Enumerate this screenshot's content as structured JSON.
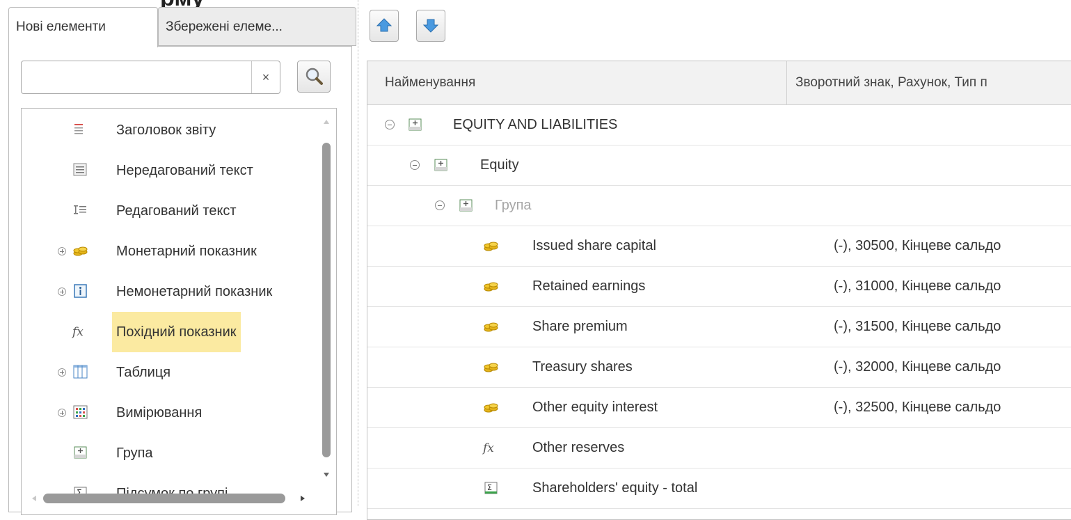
{
  "window": {
    "partial_title": "рму"
  },
  "left_panel": {
    "tabs": [
      {
        "label": "Нові елементи",
        "active": true
      },
      {
        "label": "Збережені елеме...",
        "active": false
      }
    ],
    "search": {
      "value": "",
      "placeholder": "",
      "clear_glyph": "×"
    },
    "items": [
      {
        "label": "Заголовок звіту",
        "icon": "report-title-icon",
        "expandable": false,
        "selected": false
      },
      {
        "label": "Нередагований текст",
        "icon": "non-editable-text-icon",
        "expandable": false,
        "selected": false
      },
      {
        "label": "Редагований текст",
        "icon": "editable-text-icon",
        "expandable": false,
        "selected": false
      },
      {
        "label": "Монетарний показник",
        "icon": "coins-icon",
        "expandable": true,
        "selected": false
      },
      {
        "label": "Немонетарний показник",
        "icon": "info-icon",
        "expandable": true,
        "selected": false
      },
      {
        "label": "Похідний показник",
        "icon": "fx-icon",
        "expandable": false,
        "selected": true
      },
      {
        "label": "Таблиця",
        "icon": "table-icon",
        "expandable": true,
        "selected": false
      },
      {
        "label": "Вимірювання",
        "icon": "dimension-grid-icon",
        "expandable": true,
        "selected": false
      },
      {
        "label": "Група",
        "icon": "group-icon",
        "expandable": false,
        "selected": false
      },
      {
        "label": "Підсумок по групі",
        "icon": "sum-icon",
        "expandable": false,
        "selected": false
      }
    ]
  },
  "toolbar": {
    "move_up": "arrow-up-icon",
    "move_down": "arrow-down-icon"
  },
  "table": {
    "columns": [
      "Найменування",
      "Зворотний знак, Рахунок, Тип п"
    ],
    "rows": [
      {
        "indent": 0,
        "expander": "collapse",
        "icon": "group-icon",
        "name": "EQUITY AND LIABILITIES",
        "detail": "",
        "muted": false
      },
      {
        "indent": 1,
        "expander": "collapse",
        "icon": "group-icon",
        "name": "Equity",
        "detail": "",
        "muted": false
      },
      {
        "indent": 2,
        "expander": "collapse",
        "icon": "group-icon",
        "name": "Група",
        "detail": "",
        "muted": true
      },
      {
        "indent": 3,
        "expander": "",
        "icon": "coins-icon",
        "name": "Issued share capital",
        "detail": "(-), 30500, Кінцеве сальдо",
        "muted": false
      },
      {
        "indent": 3,
        "expander": "",
        "icon": "coins-icon",
        "name": "Retained earnings",
        "detail": "(-), 31000, Кінцеве сальдо",
        "muted": false
      },
      {
        "indent": 3,
        "expander": "",
        "icon": "coins-icon",
        "name": "Share premium",
        "detail": "(-), 31500, Кінцеве сальдо",
        "muted": false
      },
      {
        "indent": 3,
        "expander": "",
        "icon": "coins-icon",
        "name": "Treasury shares",
        "detail": "(-), 32000, Кінцеве сальдо",
        "muted": false
      },
      {
        "indent": 3,
        "expander": "",
        "icon": "coins-icon",
        "name": "Other equity interest",
        "detail": "(-), 32500, Кінцеве сальдо",
        "muted": false
      },
      {
        "indent": 3,
        "expander": "",
        "icon": "fx-icon",
        "name": "Other reserves",
        "detail": "",
        "muted": false
      },
      {
        "indent": 3,
        "expander": "",
        "icon": "sum-icon",
        "name": "Shareholders' equity - total",
        "detail": "",
        "muted": false
      }
    ]
  },
  "colors": {
    "selection": "#fbeaa1",
    "header_bg": "#f2f2f2",
    "border": "#b9b9b9",
    "arrow_blue": "#3a8fd8"
  }
}
